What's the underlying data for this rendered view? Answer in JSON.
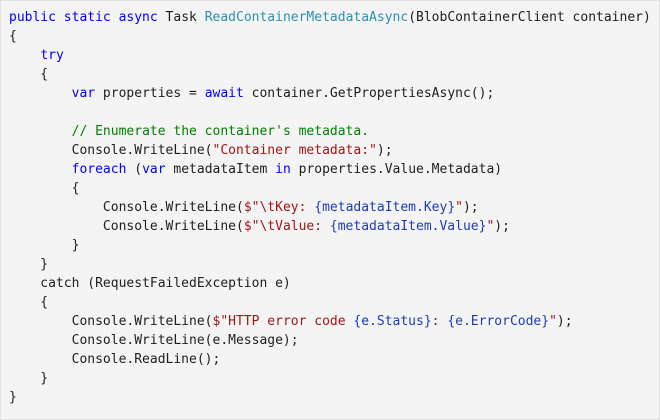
{
  "language": "C#",
  "colors": {
    "background": "#f4f4f4",
    "keyword": "#0000ff",
    "type": "#2b91af",
    "string": "#a31515",
    "comment": "#008000",
    "interpolation": "#1e3cb4",
    "plain": "#1e1e1e"
  },
  "lines": [
    [
      [
        "keyword",
        "public static async "
      ],
      [
        "plain",
        "Task "
      ],
      [
        "type",
        "ReadContainerMetadataAsync"
      ],
      [
        "plain",
        "(BlobContainerClient container)"
      ]
    ],
    [
      [
        "plain",
        "{"
      ]
    ],
    [
      [
        "plain",
        "    "
      ],
      [
        "keyword",
        "try"
      ]
    ],
    [
      [
        "plain",
        "    {"
      ]
    ],
    [
      [
        "plain",
        "        "
      ],
      [
        "keyword",
        "var"
      ],
      [
        "plain",
        " properties = "
      ],
      [
        "keyword",
        "await"
      ],
      [
        "plain",
        " container.GetPropertiesAsync();"
      ]
    ],
    [
      [
        "plain",
        ""
      ]
    ],
    [
      [
        "plain",
        "        "
      ],
      [
        "comment",
        "// Enumerate the container's metadata."
      ]
    ],
    [
      [
        "plain",
        "        Console.WriteLine("
      ],
      [
        "string",
        "\"Container metadata:\""
      ],
      [
        "plain",
        ");"
      ]
    ],
    [
      [
        "plain",
        "        "
      ],
      [
        "keyword",
        "foreach"
      ],
      [
        "plain",
        " ("
      ],
      [
        "keyword",
        "var"
      ],
      [
        "plain",
        " metadataItem "
      ],
      [
        "keyword",
        "in"
      ],
      [
        "plain",
        " properties.Value.Metadata)"
      ]
    ],
    [
      [
        "plain",
        "        {"
      ]
    ],
    [
      [
        "plain",
        "            Console.WriteLine("
      ],
      [
        "string",
        "$\"\\tKey: "
      ],
      [
        "interp",
        "{metadataItem.Key}"
      ],
      [
        "string",
        "\""
      ],
      [
        "plain",
        ");"
      ]
    ],
    [
      [
        "plain",
        "            Console.WriteLine("
      ],
      [
        "string",
        "$\"\\tValue: "
      ],
      [
        "interp",
        "{metadataItem.Value}"
      ],
      [
        "string",
        "\""
      ],
      [
        "plain",
        ");"
      ]
    ],
    [
      [
        "plain",
        "        }"
      ]
    ],
    [
      [
        "plain",
        "    }"
      ]
    ],
    [
      [
        "plain",
        "    catch (RequestFailedException e)"
      ]
    ],
    [
      [
        "plain",
        "    {"
      ]
    ],
    [
      [
        "plain",
        "        Console.WriteLine("
      ],
      [
        "string",
        "$\"HTTP error code "
      ],
      [
        "interp",
        "{e.Status}"
      ],
      [
        "string",
        ": "
      ],
      [
        "interp",
        "{e.ErrorCode}"
      ],
      [
        "string",
        "\""
      ],
      [
        "plain",
        ");"
      ]
    ],
    [
      [
        "plain",
        "        Console.WriteLine(e.Message);"
      ]
    ],
    [
      [
        "plain",
        "        Console.ReadLine();"
      ]
    ],
    [
      [
        "plain",
        "    }"
      ]
    ],
    [
      [
        "plain",
        "}"
      ]
    ]
  ]
}
